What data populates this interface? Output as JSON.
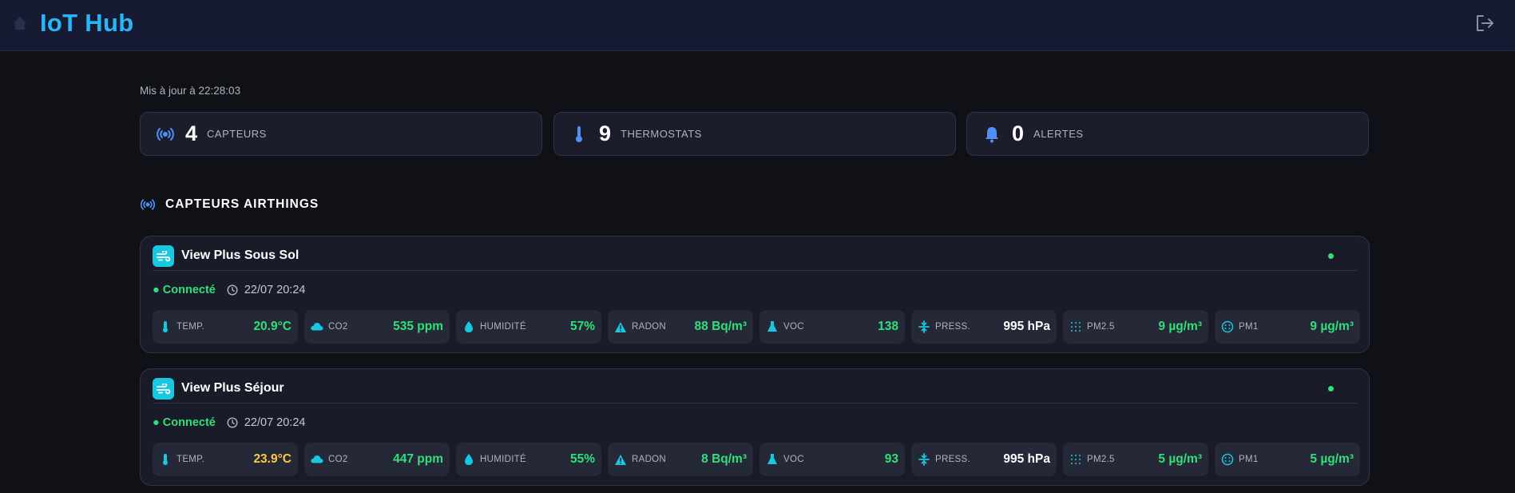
{
  "app": {
    "title": "IoT Hub"
  },
  "icons": {
    "home": "home-icon",
    "logout": "logout-icon"
  },
  "updated": "Mis à jour à 22:28:03",
  "stats": [
    {
      "value": "4",
      "label": "CAPTEURS",
      "icon": "sensor-broadcast-icon"
    },
    {
      "value": "9",
      "label": "THERMOSTATS",
      "icon": "thermometer-icon"
    },
    {
      "value": "0",
      "label": "ALERTES",
      "icon": "bell-icon"
    }
  ],
  "section": {
    "title": "CAPTEURS AIRTHINGS",
    "icon": "sensor-broadcast-icon"
  },
  "colors": {
    "accent": "#29b6f6",
    "ok": "#2ee07a",
    "warn": "#ffc93c",
    "icon_cyan": "#18c8e0"
  },
  "devices": [
    {
      "name": "View Plus Sous Sol",
      "status": "● Connecté",
      "last_seen": "22/07 20:24",
      "metrics": [
        {
          "label": "TEMP.",
          "value": "20.9°C",
          "state": "good",
          "icon": "thermometer-icon"
        },
        {
          "label": "CO2",
          "value": "535 ppm",
          "state": "good",
          "icon": "cloud-icon"
        },
        {
          "label": "HUMIDITÉ",
          "value": "57%",
          "state": "good",
          "icon": "droplet-icon"
        },
        {
          "label": "RADON",
          "value": "88 Bq/m³",
          "state": "good",
          "icon": "radon-warning-icon"
        },
        {
          "label": "VOC",
          "value": "138",
          "state": "good",
          "icon": "flask-icon"
        },
        {
          "label": "PRESS.",
          "value": "995 hPa",
          "state": "neutral",
          "icon": "pressure-icon"
        },
        {
          "label": "PM2.5",
          "value": "9 µg/m³",
          "state": "good",
          "icon": "particles-grid-icon"
        },
        {
          "label": "PM1",
          "value": "9 µg/m³",
          "state": "good",
          "icon": "particles-circle-icon"
        }
      ]
    },
    {
      "name": "View Plus Séjour",
      "status": "● Connecté",
      "last_seen": "22/07 20:24",
      "metrics": [
        {
          "label": "TEMP.",
          "value": "23.9°C",
          "state": "warn",
          "icon": "thermometer-icon"
        },
        {
          "label": "CO2",
          "value": "447 ppm",
          "state": "good",
          "icon": "cloud-icon"
        },
        {
          "label": "HUMIDITÉ",
          "value": "55%",
          "state": "good",
          "icon": "droplet-icon"
        },
        {
          "label": "RADON",
          "value": "8 Bq/m³",
          "state": "good",
          "icon": "radon-warning-icon"
        },
        {
          "label": "VOC",
          "value": "93",
          "state": "good",
          "icon": "flask-icon"
        },
        {
          "label": "PRESS.",
          "value": "995 hPa",
          "state": "neutral",
          "icon": "pressure-icon"
        },
        {
          "label": "PM2.5",
          "value": "5 µg/m³",
          "state": "good",
          "icon": "particles-grid-icon"
        },
        {
          "label": "PM1",
          "value": "5 µg/m³",
          "state": "good",
          "icon": "particles-circle-icon"
        }
      ]
    }
  ]
}
